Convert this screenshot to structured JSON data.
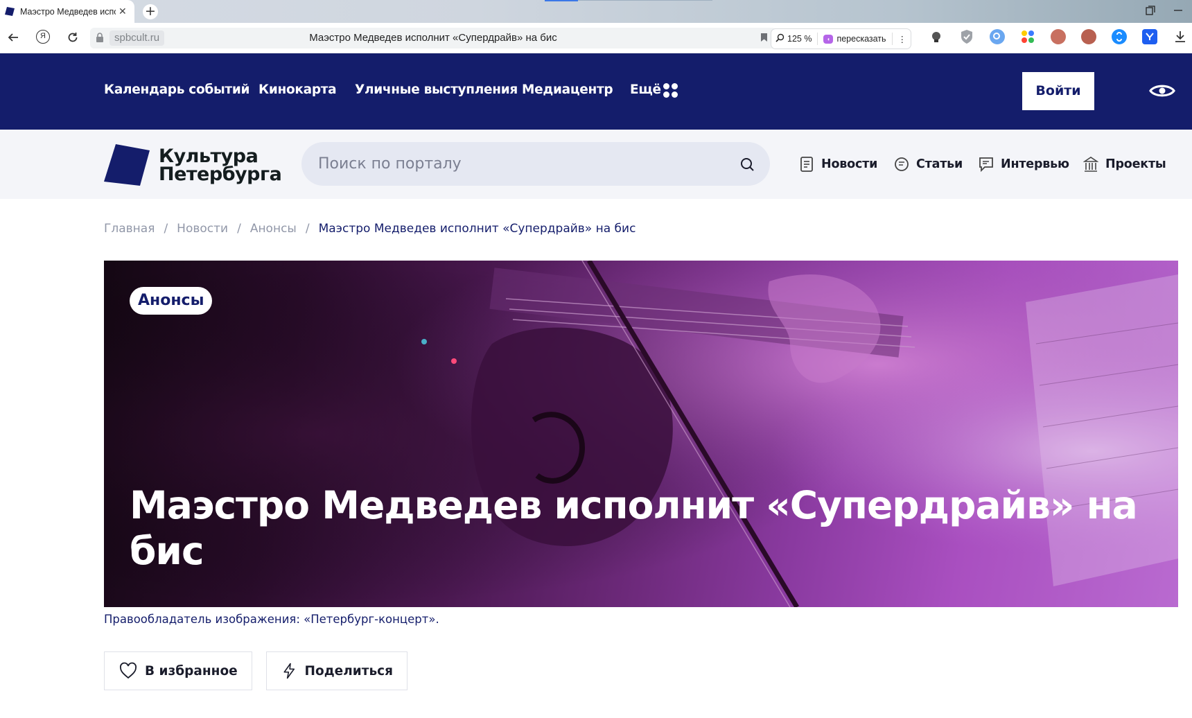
{
  "browser": {
    "tab_title": "Маэстро Медведев исполнит «Супердрайв» на бис",
    "tab_close": "✕",
    "new_tab": "+",
    "url_domain": "spbcult.ru",
    "url_page_title": "Маэстро Медведев исполнит «Супердрайв» на бис",
    "zoom": "125 %",
    "retell": "пересказать",
    "more": "⋮",
    "yandex_button": "Я",
    "extensions": [
      "ext-lightbulb",
      "ext-shield",
      "ext-search",
      "ext-apps",
      "ext-mascot",
      "ext-mascot-2",
      "ext-shazam",
      "ext-yandex-y"
    ]
  },
  "site_nav": {
    "items": [
      "Календарь событий",
      "Кинокарта",
      "Уличные выступления",
      "Медиацентр",
      "Ещё"
    ],
    "login": "Войти"
  },
  "subheader": {
    "logo_line1": "Культура",
    "logo_line2": "Петербурга",
    "search_placeholder": "Поиск по порталу",
    "links": [
      "Новости",
      "Статьи",
      "Интервью",
      "Проекты"
    ]
  },
  "breadcrumb": {
    "items": [
      "Главная",
      "Новости",
      "Анонсы"
    ],
    "separator": "/",
    "current": "Маэстро Медведев исполнит «Супердрайв» на бис"
  },
  "article": {
    "badge": "Анонсы",
    "title": "Маэстро Медведев исполнит «Супердрайв» на бис",
    "image_credit": "Правообладатель изображения: «Петербург-концерт».",
    "favorite_button": "В избранное",
    "share_button": "Поделиться"
  },
  "colors": {
    "brand_navy": "#141d6b",
    "subheader_bg": "#f4f5f9",
    "search_bg": "#e5e8f2"
  }
}
